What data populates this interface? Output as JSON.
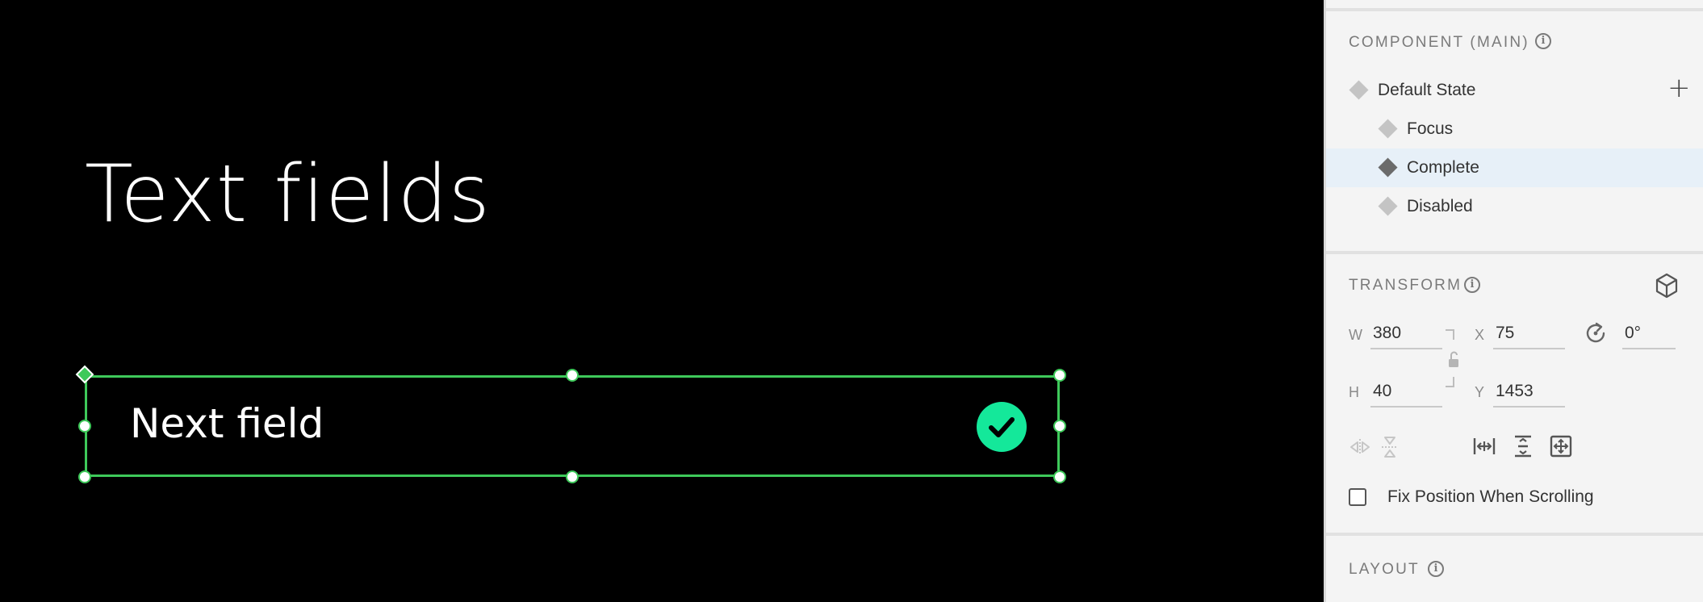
{
  "canvas": {
    "title": "Text fields",
    "field_text": "Next field",
    "accent": "#3ec95a",
    "check_color": "#14e89a"
  },
  "panel": {
    "component": {
      "heading": "COMPONENT (MAIN)",
      "states": [
        {
          "label": "Default State",
          "level": 0,
          "selected": false
        },
        {
          "label": "Focus",
          "level": 1,
          "selected": false
        },
        {
          "label": "Complete",
          "level": 1,
          "selected": true
        },
        {
          "label": "Disabled",
          "level": 1,
          "selected": false
        }
      ]
    },
    "transform": {
      "heading": "TRANSFORM",
      "w_label": "W",
      "w_value": "380",
      "h_label": "H",
      "h_value": "40",
      "x_label": "X",
      "x_value": "75",
      "y_label": "Y",
      "y_value": "1453",
      "rotation_value": "0°"
    },
    "fix_position": {
      "label": "Fix Position When Scrolling",
      "checked": false
    },
    "layout": {
      "heading": "LAYOUT"
    }
  }
}
